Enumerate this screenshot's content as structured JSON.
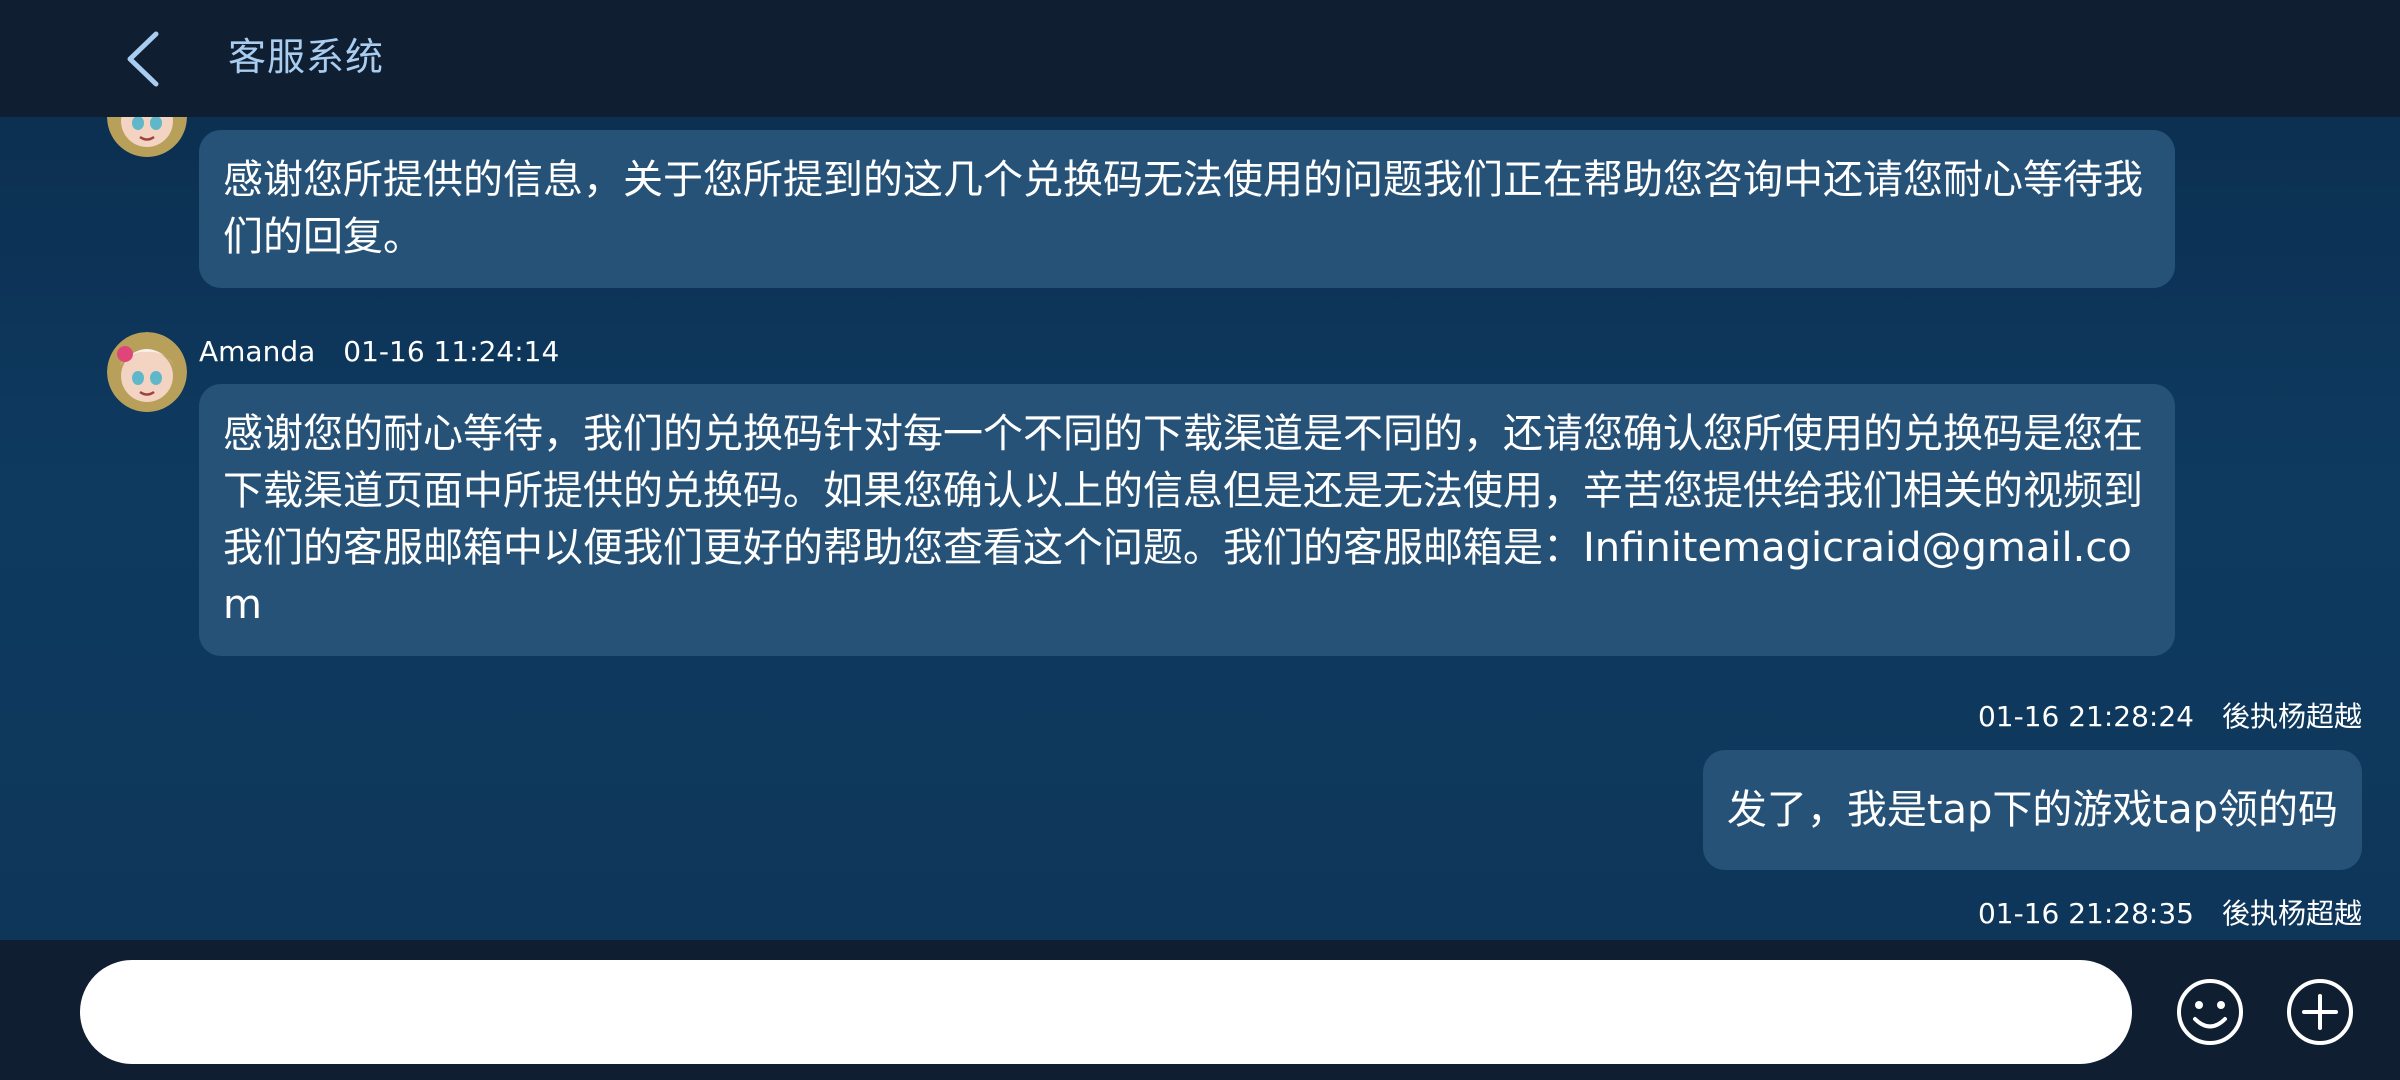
{
  "header": {
    "title": "客服系统",
    "back_icon": "chevron-left-icon"
  },
  "colors": {
    "header_bg": "#0f1f31",
    "chat_bg": "#0d3557",
    "bubble_bg": "#275278",
    "title_color": "#a9cdf0",
    "text_color": "#ffffff",
    "input_bg": "#ffffff"
  },
  "messages": [
    {
      "side": "left",
      "avatar_icon": "agent-avatar",
      "text": "感谢您所提供的信息，关于您所提到的这几个兑换码无法使用的问题我们正在帮助您咨询中还请您耐心等待我们的回复。"
    },
    {
      "side": "left",
      "sender": "Amanda",
      "time": "01-16 11:24:14",
      "avatar_icon": "agent-avatar",
      "text": "感谢您的耐心等待，我们的兑换码针对每一个不同的下载渠道是不同的，还请您确认您所使用的兑换码是您在下载渠道页面中所提供的兑换码。如果您确认以上的信息但是还是无法使用，辛苦您提供给我们相关的视频到我们的客服邮箱中以便我们更好的帮助您查看这个问题。我们的客服邮箱是：Infinitemagicraid@gmail.com"
    },
    {
      "side": "right",
      "sender": "後执杨超越",
      "time": "01-16 21:28:24",
      "text": "发了，我是tap下的游戏tap领的码"
    },
    {
      "side": "right",
      "sender": "後执杨超越",
      "time": "01-16 21:28:35"
    }
  ],
  "composer": {
    "value": "",
    "placeholder": "",
    "emoji_icon": "smiley-icon",
    "add_icon": "plus-circle-icon"
  }
}
